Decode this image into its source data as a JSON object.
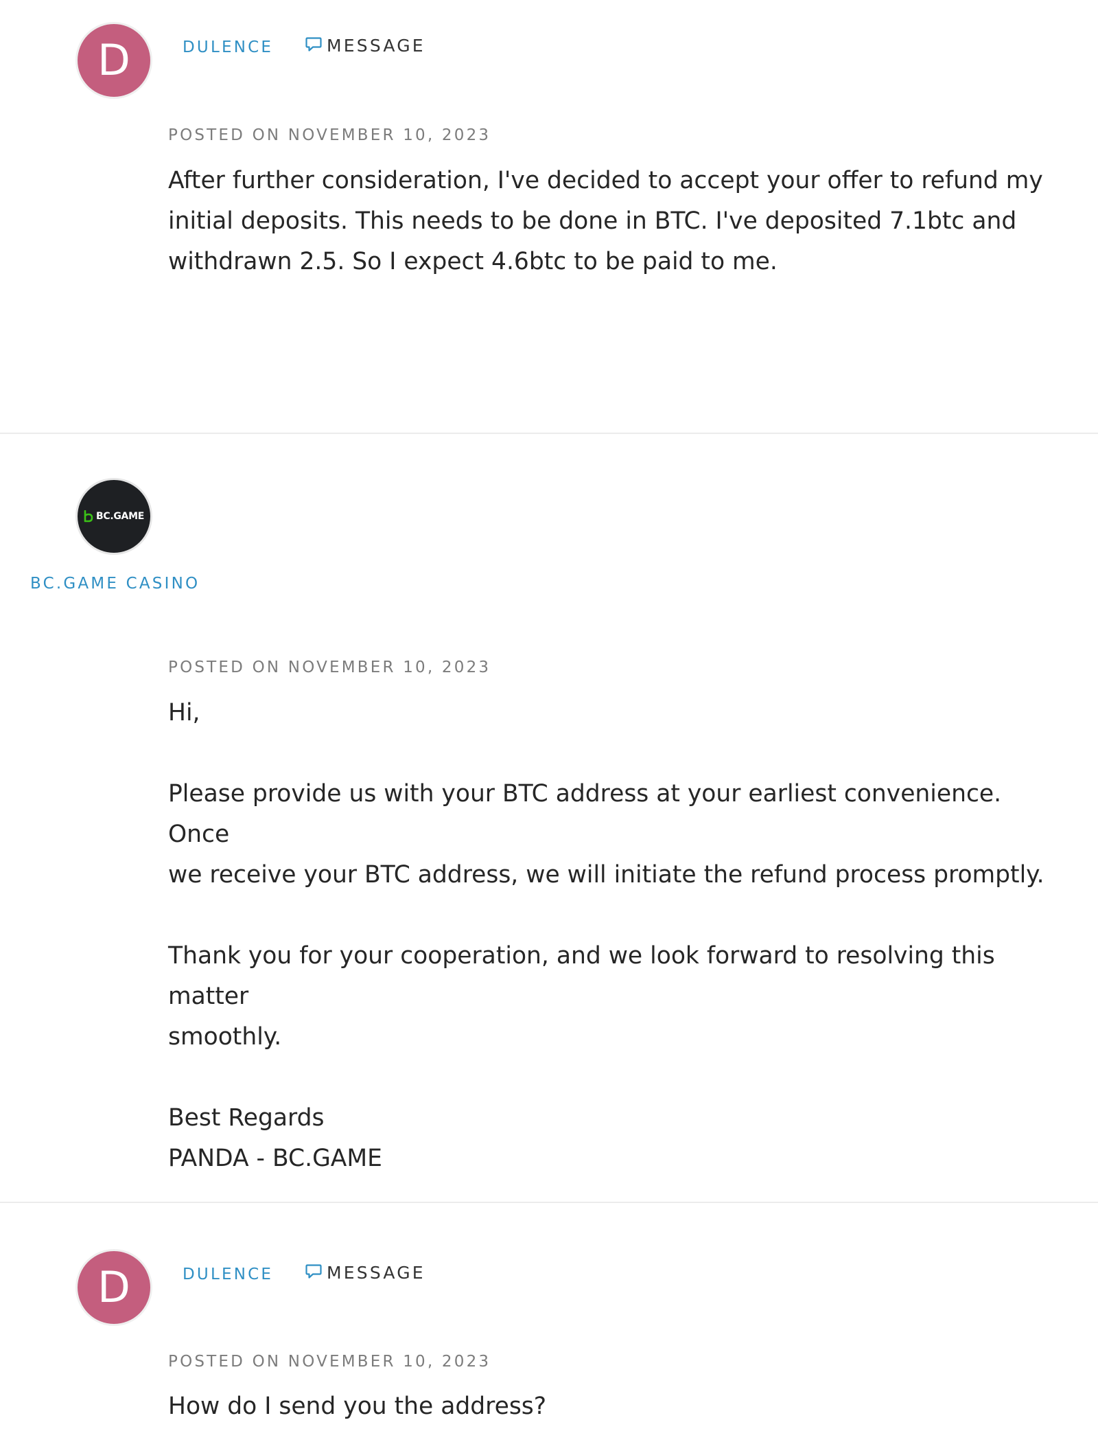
{
  "posts": [
    {
      "author": "DULENCE",
      "avatar_letter": "D",
      "avatar_color": "#c45e7e",
      "message_label": "MESSAGE",
      "posted": "POSTED ON NOVEMBER 10, 2023",
      "body": [
        "After further consideration, I've decided to accept your offer to refund my",
        "initial deposits. This needs to be done in BTC. I've deposited 7.1btc and",
        "withdrawn 2.5. So I expect 4.6btc to be paid to me."
      ]
    },
    {
      "author": "BC.GAME CASINO",
      "logo_text": "BC.GAME",
      "posted": "POSTED ON NOVEMBER 10, 2023",
      "body": {
        "greeting": "Hi,",
        "para1_line1": "Please provide us with your BTC address at your earliest convenience. Once",
        "para1_line2": "we receive your BTC address, we will initiate the refund process promptly.",
        "para2_line1": "Thank you for your cooperation, and we look forward to resolving this matter",
        "para2_line2": "smoothly.",
        "signoff": "Best Regards",
        "signature": "PANDA - BC.GAME"
      }
    },
    {
      "author": "DULENCE",
      "avatar_letter": "D",
      "avatar_color": "#c45e7e",
      "message_label": "MESSAGE",
      "posted": "POSTED ON NOVEMBER 10, 2023",
      "body": [
        "How do I send you the address?"
      ]
    }
  ],
  "colors": {
    "link": "#2f8fc4",
    "logo_green": "#3bc117",
    "divider": "#ececec"
  },
  "icons": {
    "message": "chat-bubble-icon",
    "logo_mark": "bcgame-b-icon"
  }
}
